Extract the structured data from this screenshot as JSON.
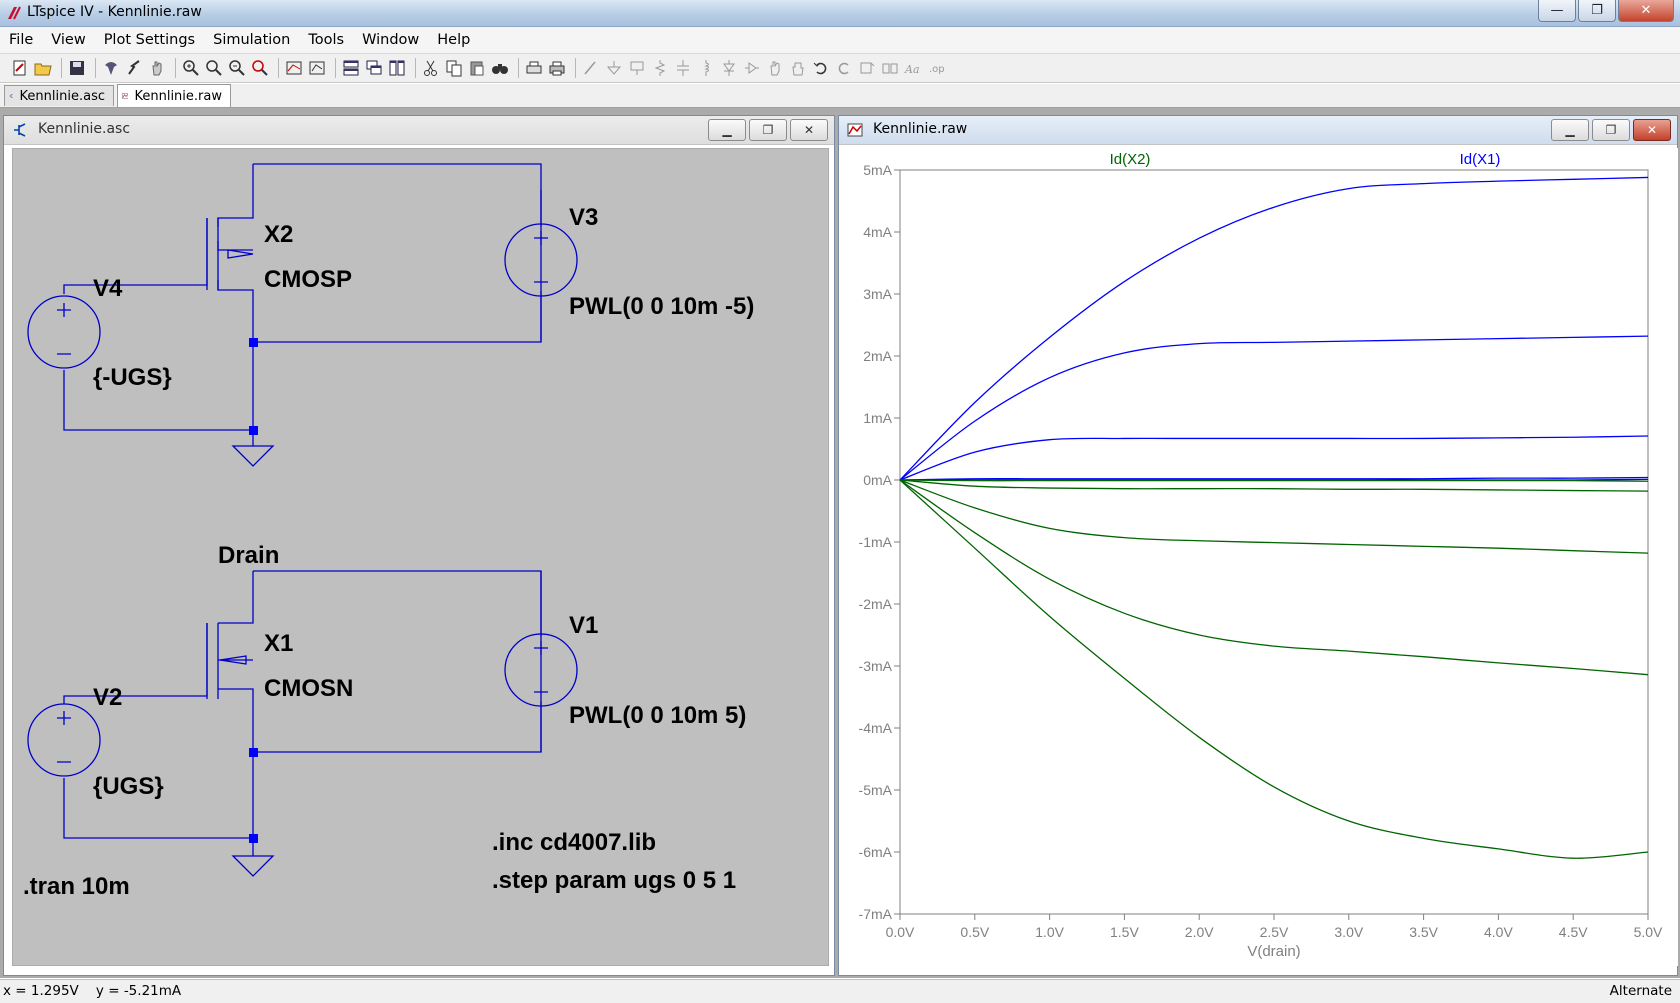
{
  "window": {
    "title": "LTspice IV - Kennlinie.raw",
    "minimize": "—",
    "maximize": "❐",
    "close": "✕"
  },
  "menu": [
    "File",
    "View",
    "Plot Settings",
    "Simulation",
    "Tools",
    "Window",
    "Help"
  ],
  "tabs": [
    {
      "label": "Kennlinie.asc",
      "icon": "schematic-icon",
      "active": false
    },
    {
      "label": "Kennlinie.raw",
      "icon": "waveform-icon",
      "active": true
    }
  ],
  "schematic_window": {
    "title": "Kennlinie.asc",
    "labels": {
      "v3": "V3",
      "x2": "X2",
      "cmosp": "CMOSP",
      "v4": "V4",
      "pwl_neg": "PWL(0 0 10m -5)",
      "ugs_neg": "{-UGS}",
      "drain": "Drain",
      "v1": "V1",
      "x1": "X1",
      "cmosn": "CMOSN",
      "v2": "V2",
      "pwl_pos": "PWL(0 0 10m 5)",
      "ugs_pos": "{UGS}",
      "inc": ".inc cd4007.lib",
      "step": ".step param ugs 0 5 1",
      "tran": ".tran 10m"
    },
    "colors": {
      "background": "#bfbfbf",
      "wire": "#0000c8",
      "junction": "#0000ff",
      "text": "#000000"
    }
  },
  "plot_window": {
    "title": "Kennlinie.raw",
    "colors": {
      "x2": "#006400",
      "x1": "#0000ff",
      "axis": "#808080",
      "grid": "#808080"
    }
  },
  "chart_data": {
    "type": "line",
    "title": "",
    "xlabel": "V(drain)",
    "ylabel": "",
    "xlim": [
      0,
      5
    ],
    "ylim": [
      -7,
      5
    ],
    "x_ticks": [
      "0.0V",
      "0.5V",
      "1.0V",
      "1.5V",
      "2.0V",
      "2.5V",
      "3.0V",
      "3.5V",
      "4.0V",
      "4.5V",
      "5.0V"
    ],
    "y_ticks": [
      "5mA",
      "4mA",
      "3mA",
      "2mA",
      "1mA",
      "0mA",
      "-1mA",
      "-2mA",
      "-3mA",
      "-4mA",
      "-5mA",
      "-6mA",
      "-7mA"
    ],
    "legend": [
      "Id(X2)",
      "Id(X1)"
    ],
    "x": [
      0,
      0.5,
      1.0,
      1.5,
      2.0,
      2.5,
      3.0,
      3.5,
      4.0,
      4.5,
      5.0
    ],
    "series": [
      {
        "name": "Id(X1)",
        "step": "ugs=0",
        "values": [
          0,
          0,
          0,
          0,
          0,
          0,
          0,
          0,
          0,
          0,
          0.01
        ]
      },
      {
        "name": "Id(X1)",
        "step": "ugs=1",
        "values": [
          0,
          0.02,
          0.02,
          0.02,
          0.02,
          0.02,
          0.02,
          0.02,
          0.03,
          0.03,
          0.04
        ]
      },
      {
        "name": "Id(X1)",
        "step": "ugs=2",
        "values": [
          0,
          0.45,
          0.65,
          0.67,
          0.67,
          0.67,
          0.67,
          0.67,
          0.68,
          0.69,
          0.71
        ]
      },
      {
        "name": "Id(X1)",
        "step": "ugs=3",
        "values": [
          0,
          0.95,
          1.65,
          2.05,
          2.2,
          2.22,
          2.24,
          2.26,
          2.28,
          2.3,
          2.32
        ]
      },
      {
        "name": "Id(X1)",
        "step": "ugs=4",
        "values": [
          0,
          1.25,
          2.3,
          3.2,
          3.9,
          4.4,
          4.7,
          4.78,
          4.82,
          4.85,
          4.88
        ]
      },
      {
        "name": "Id(X2)",
        "step": "ugs=0",
        "values": [
          0,
          -0.01,
          -0.01,
          -0.01,
          -0.01,
          -0.01,
          -0.01,
          -0.01,
          -0.01,
          -0.01,
          -0.02
        ]
      },
      {
        "name": "Id(X2)",
        "step": "ugs=1",
        "values": [
          0,
          -0.1,
          -0.13,
          -0.14,
          -0.14,
          -0.14,
          -0.15,
          -0.15,
          -0.16,
          -0.17,
          -0.18
        ]
      },
      {
        "name": "Id(X2)",
        "step": "ugs=2",
        "values": [
          0,
          -0.45,
          -0.78,
          -0.93,
          -0.98,
          -1.01,
          -1.04,
          -1.07,
          -1.1,
          -1.14,
          -1.18
        ]
      },
      {
        "name": "Id(X2)",
        "step": "ugs=3",
        "values": [
          0,
          -0.85,
          -1.6,
          -2.15,
          -2.5,
          -2.68,
          -2.76,
          -2.85,
          -2.95,
          -3.04,
          -3.14
        ]
      },
      {
        "name": "Id(X2)",
        "step": "ugs=4",
        "values": [
          0,
          -1.1,
          -2.2,
          -3.2,
          -4.15,
          -4.95,
          -5.5,
          -5.78,
          -5.95,
          -6.1,
          -6.0
        ]
      }
    ],
    "grid": false,
    "legend_placement": "top"
  },
  "status": {
    "coords": "x = 1.295V    y = -5.21mA",
    "mode": "Alternate"
  }
}
